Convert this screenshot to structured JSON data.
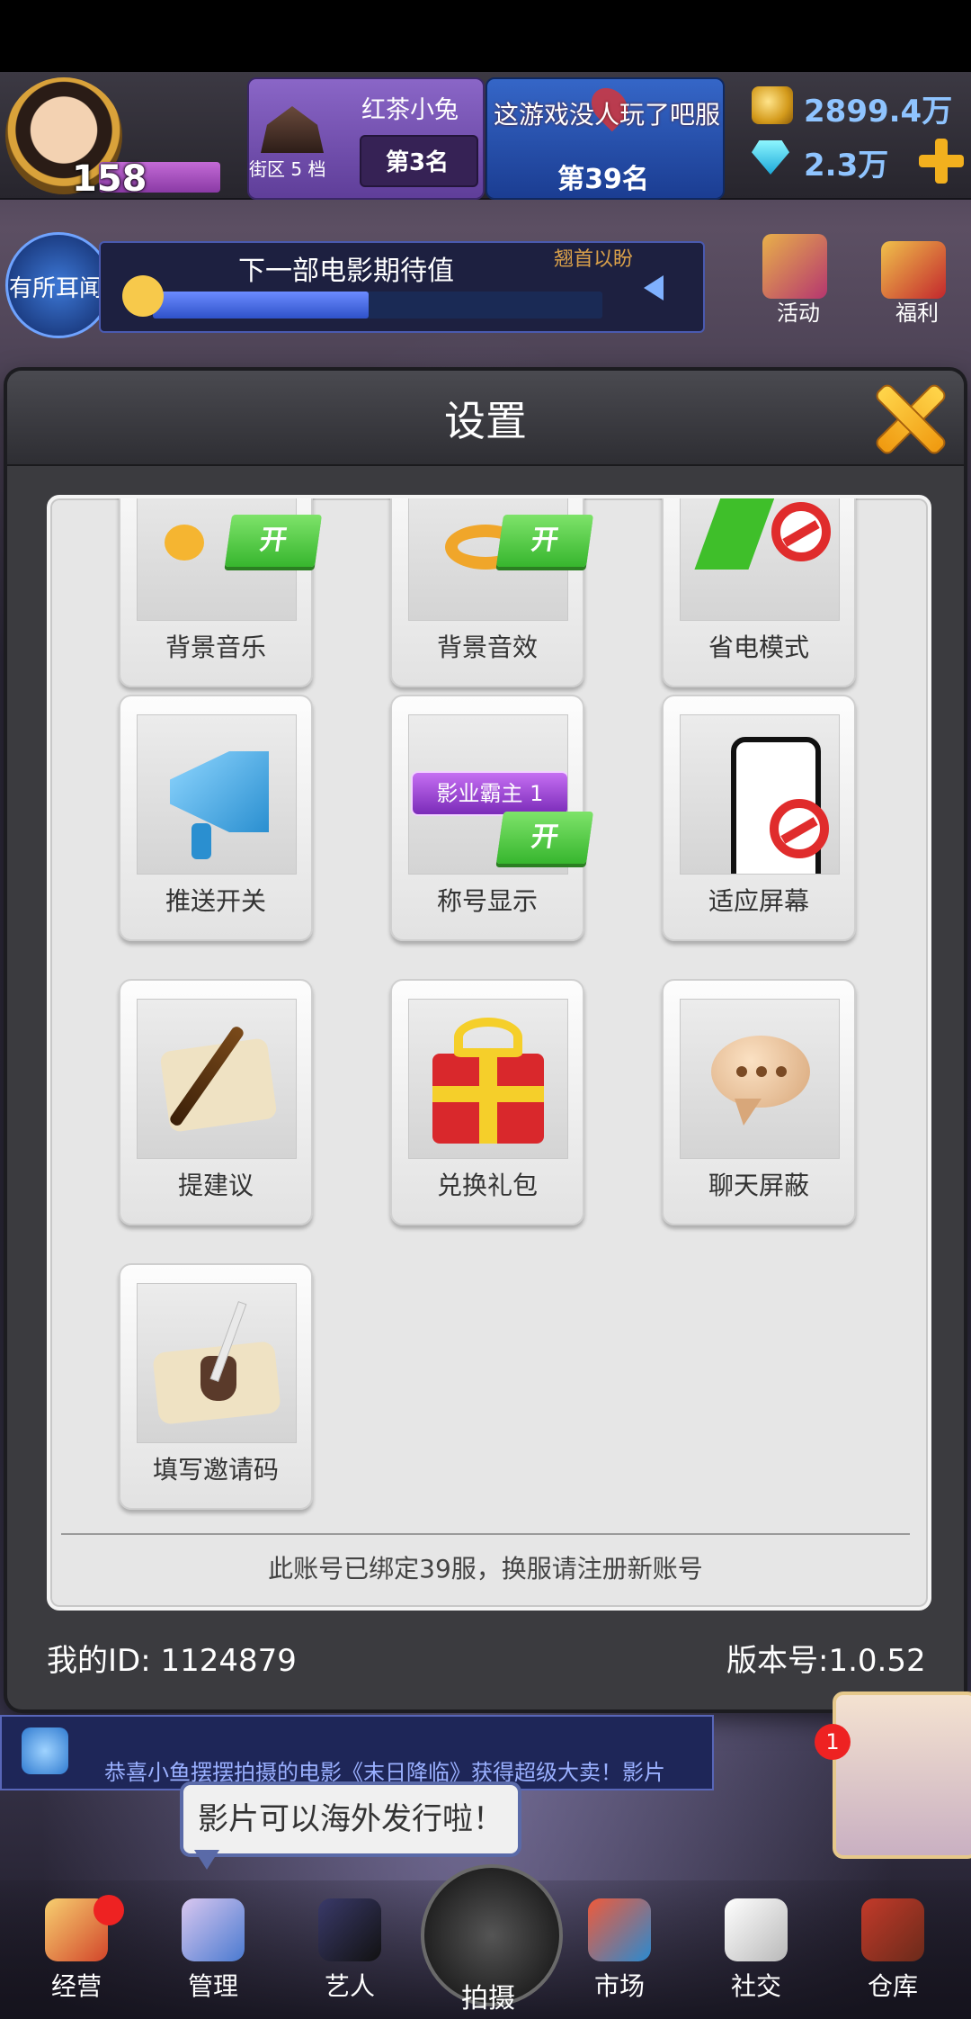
{
  "hud": {
    "level": "158",
    "district_name": "红茶小兔",
    "district_label": "街区 5 档",
    "district_rank": "第3名",
    "server_name": "这游戏没人玩了吧服",
    "server_rank": "第39名",
    "gold": "2899.4万",
    "gems": "2.3万"
  },
  "row2": {
    "news_label": "有所耳闻",
    "movie_title": "下一部电影期待值",
    "movie_hint": "翘首以盼",
    "movie_progress": 0.48,
    "activity_label": "活动",
    "welfare_label": "福利"
  },
  "settings": {
    "title": "设置",
    "tiles": [
      {
        "label": "背景音乐",
        "state": "开",
        "icon": "music-note-icon"
      },
      {
        "label": "背景音效",
        "state": "开",
        "icon": "sound-effect-icon"
      },
      {
        "label": "省电模式",
        "state": "off",
        "icon": "battery-icon"
      },
      {
        "label": "推送开关",
        "state": "",
        "icon": "megaphone-icon"
      },
      {
        "label": "称号显示",
        "state": "开",
        "icon": "title-badge-icon",
        "badge_text": "影业霸主 1"
      },
      {
        "label": "适应屏幕",
        "state": "off",
        "icon": "phone-screen-icon"
      },
      {
        "label": "提建议",
        "state": "",
        "icon": "quill-scroll-icon"
      },
      {
        "label": "兑换礼包",
        "state": "",
        "icon": "gift-box-icon"
      },
      {
        "label": "聊天屏蔽",
        "state": "",
        "icon": "chat-bubble-icon"
      },
      {
        "label": "填写邀请码",
        "state": "",
        "icon": "ink-scroll-icon"
      }
    ],
    "footer_note": "此账号已绑定39服，换服请注册新账号",
    "my_id": "我的ID: 1124879",
    "version": "版本号:1.0.52"
  },
  "ticker": {
    "text": "恭喜小鱼摆摆拍摄的电影《末日降临》获得超级大卖！影片"
  },
  "tooltip": "影片可以海外发行啦！",
  "notification_count": "1",
  "nav": {
    "items": [
      "经营",
      "管理",
      "艺人",
      "拍摄",
      "市场",
      "社交",
      "仓库"
    ]
  },
  "colors": {
    "accent_gold": "#f2b01e",
    "toggle_on": "#37b62e",
    "disabled_red": "#e02c2c"
  }
}
